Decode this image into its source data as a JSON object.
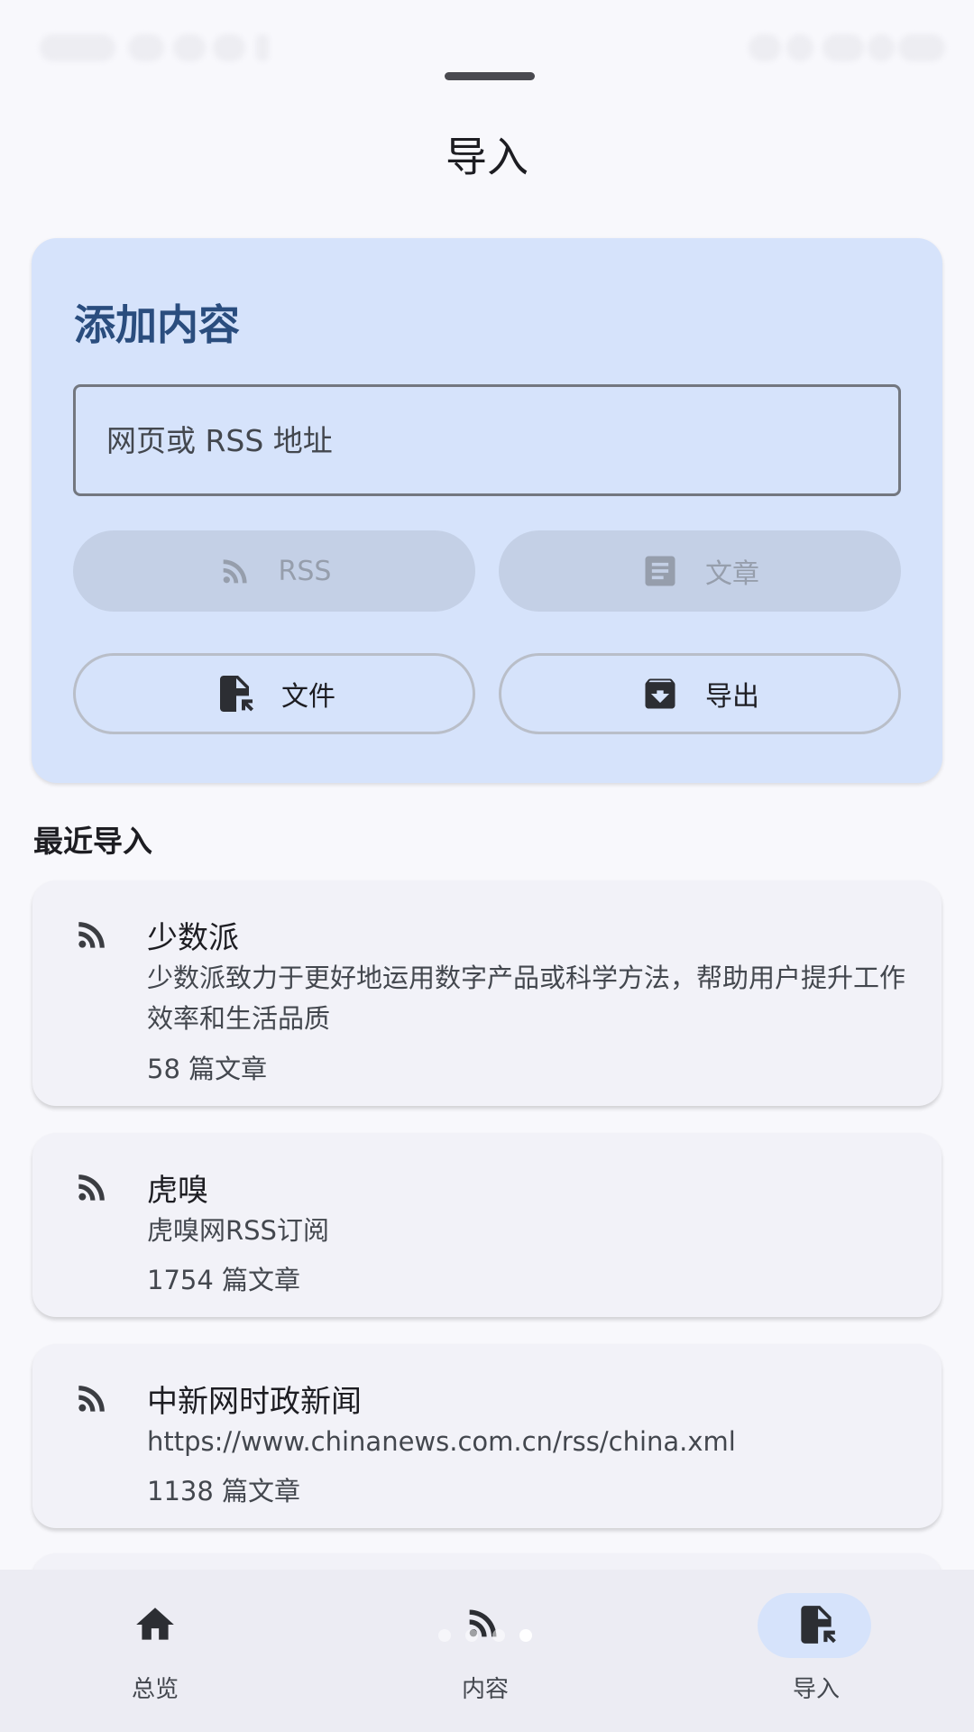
{
  "page": {
    "title": "导入"
  },
  "add_content": {
    "title": "添加内容",
    "url_placeholder": "网页或 RSS 地址",
    "buttons": {
      "rss": "RSS",
      "article": "文章",
      "file": "文件",
      "export": "导出"
    }
  },
  "recent": {
    "title": "最近导入",
    "feeds": [
      {
        "name": "少数派",
        "description": "少数派致力于更好地运用数字产品或科学方法，帮助用户提升工作效率和生活品质",
        "count": "58 篇文章",
        "icon": "rss-icon"
      },
      {
        "name": "虎嗅",
        "description": "虎嗅网RSS订阅",
        "count": "1754 篇文章",
        "icon": "rss-icon"
      },
      {
        "name": "中新网时政新闻",
        "description": "https://www.chinanews.com.cn/rss/china.xml",
        "count": "1138 篇文章",
        "icon": "rss-icon"
      }
    ]
  },
  "bottom_nav": {
    "items": [
      {
        "label": "总览",
        "icon": "home-icon",
        "selected": false
      },
      {
        "label": "内容",
        "icon": "rss-icon",
        "selected": false
      },
      {
        "label": "导入",
        "icon": "file-import-icon",
        "selected": true
      }
    ]
  },
  "colors": {
    "card_background": "#d6e3fb",
    "card_title": "#2a4d7e",
    "page_background": "#f8f8fc",
    "nav_background": "#ececf3",
    "nav_selected_indicator": "#d6e3fb"
  }
}
